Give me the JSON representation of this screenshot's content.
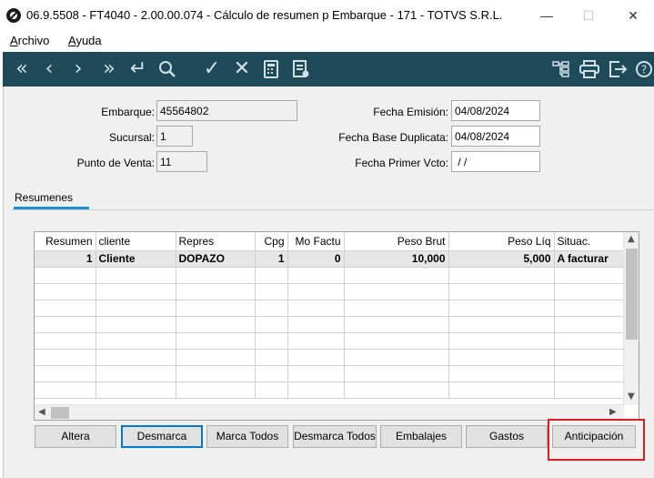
{
  "window": {
    "title": "06.9.5508 - FT4040 - 2.00.00.074 - Cálculo de resumen p Embarque - 171 - TOTVS S.R.L.",
    "minimize": "—",
    "maximize": "☐",
    "close": "✕"
  },
  "menu": {
    "archivo_acc": "A",
    "archivo_rest": "rchivo",
    "ayuda_acc": "A",
    "ayuda_rest": "yuda"
  },
  "toolbar_icons": [
    "first-icon",
    "previous-icon",
    "next-icon",
    "last-icon",
    "return-icon",
    "search-icon",
    "confirm-icon",
    "cancel-icon",
    "calculator-icon",
    "notes-icon",
    "tree-icon",
    "print-icon",
    "exit-icon",
    "help-icon"
  ],
  "form": {
    "embarque_label": "Embarque:",
    "embarque_value": "45564802",
    "sucursal_label": "Sucursal:",
    "sucursal_value": "1",
    "punto_label": "Punto de Venta:",
    "punto_value": "11",
    "fecha_emision_label": "Fecha Emisión:",
    "fecha_emision_value": "04/08/2024",
    "fecha_base_label": "Fecha Base Duplicata:",
    "fecha_base_value": "04/08/2024",
    "fecha_primer_label": "Fecha Primer Vcto:",
    "fecha_primer_value": " / /"
  },
  "tab": {
    "label": "Resumenes"
  },
  "grid": {
    "columns": [
      "Resumen",
      "cliente",
      "Repres",
      "Cpg",
      "Mo Factu",
      "Peso Brut",
      "Peso Líq",
      "Situac."
    ],
    "rows": [
      [
        "1",
        "Cliente",
        "DOPAZO",
        "1",
        "0",
        "10,000",
        "5,000",
        "A facturar"
      ]
    ]
  },
  "buttons": {
    "altera": "Altera",
    "desmarca": "Desmarca",
    "marca_todos": "Marca Todos",
    "desmarca_todos": "Desmarca Todos",
    "embalajes": "Embalajes",
    "gastos": "Gastos",
    "anticipacion": "Anticipación"
  },
  "colors": {
    "toolbar": "#1e4a5a",
    "highlight": "#e01e1e",
    "focus": "#0078d7"
  }
}
